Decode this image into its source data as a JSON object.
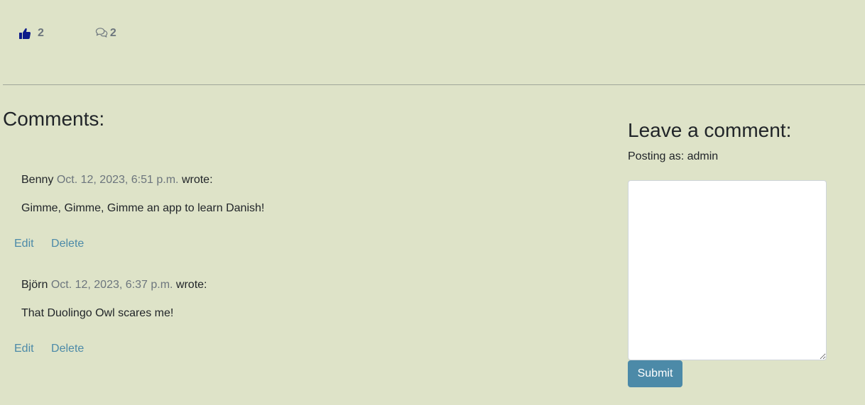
{
  "stats": {
    "likes_icon": "thumbs-up-icon",
    "likes_count": "2",
    "comments_icon": "comments-icon",
    "comments_count": "2"
  },
  "comments_section": {
    "heading": "Comments:",
    "items": [
      {
        "author": "Benny",
        "date": "Oct. 12, 2023, 6:51 p.m.",
        "wrote": "wrote:",
        "body": "Gimme, Gimme, Gimme an app to learn Danish!",
        "edit_label": "Edit",
        "delete_label": "Delete"
      },
      {
        "author": "Björn",
        "date": "Oct. 12, 2023, 6:37 p.m.",
        "wrote": "wrote:",
        "body": "That Duolingo Owl scares me!",
        "edit_label": "Edit",
        "delete_label": "Delete"
      }
    ]
  },
  "comment_form": {
    "heading": "Leave a comment:",
    "posting_as": "Posting as: admin",
    "textarea_value": "",
    "submit_label": "Submit"
  },
  "colors": {
    "page_background": "#dee3c8",
    "like_icon": "#0d1b8a",
    "muted_text": "#6c757d",
    "link": "#4c8aa8",
    "button": "#4c8aa8"
  }
}
